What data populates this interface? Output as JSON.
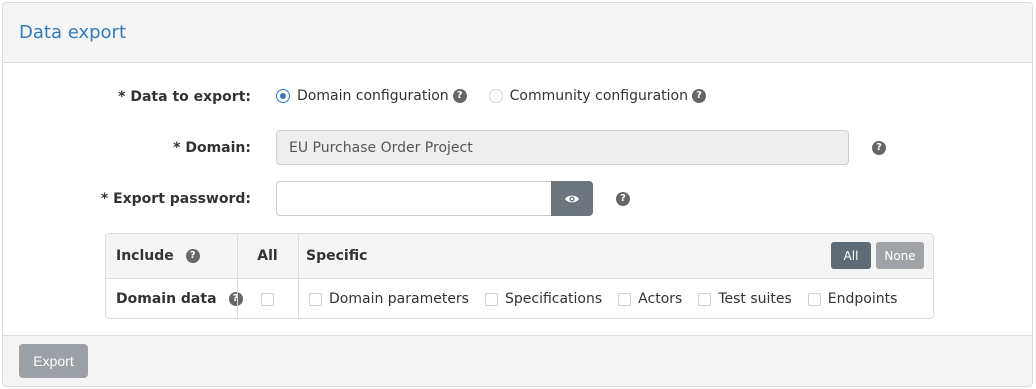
{
  "panel": {
    "title": "Data export"
  },
  "form": {
    "data_to_export": {
      "label": "* Data to export:",
      "options": [
        {
          "label": "Domain configuration",
          "selected": true
        },
        {
          "label": "Community configuration",
          "selected": false
        }
      ]
    },
    "domain": {
      "label": "* Domain:",
      "value": "EU Purchase Order Project"
    },
    "password": {
      "label": "* Export password:",
      "value": "",
      "toggle_icon": "eye-icon"
    },
    "help_glyph": "?"
  },
  "table": {
    "headers": {
      "include": "Include",
      "all": "All",
      "specific": "Specific"
    },
    "buttons": {
      "all": "All",
      "none": "None"
    },
    "row": {
      "label": "Domain data",
      "items": [
        "Domain parameters",
        "Specifications",
        "Actors",
        "Test suites",
        "Endpoints"
      ]
    }
  },
  "footer": {
    "export_label": "Export"
  },
  "colors": {
    "accent": "#337ab7",
    "eye_button": "#6c757d",
    "export_button": "#9aa0a6"
  }
}
